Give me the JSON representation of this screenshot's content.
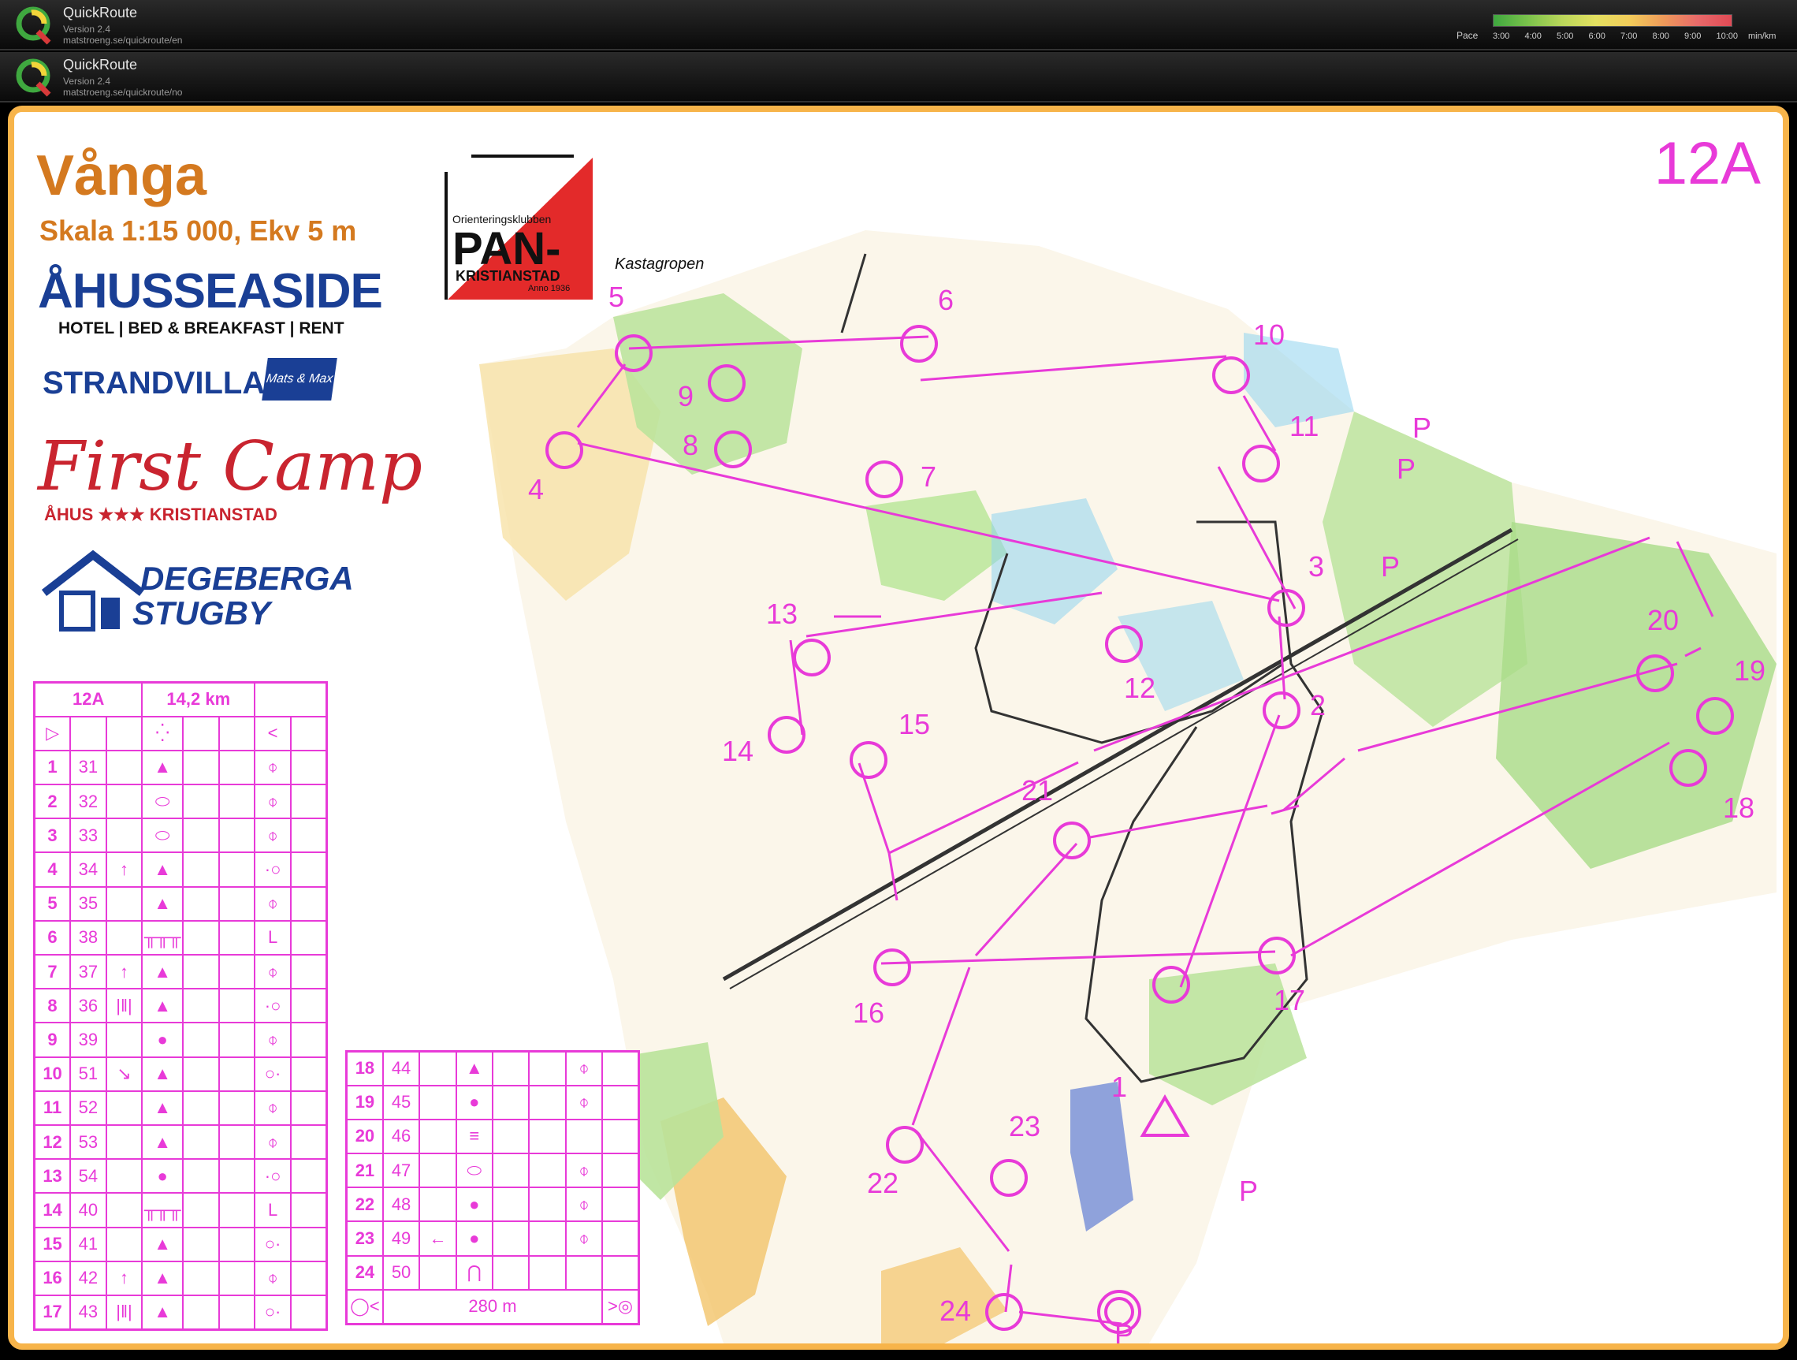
{
  "app_bars": [
    {
      "title": "QuickRoute",
      "version": "Version 2.4",
      "url": "matstroeng.se/quickroute/en"
    },
    {
      "title": "QuickRoute",
      "version": "Version 2.4",
      "url": "matstroeng.se/quickroute/no"
    }
  ],
  "pace_legend": {
    "label": "Pace",
    "ticks": [
      "3:00",
      "4:00",
      "5:00",
      "6:00",
      "7:00",
      "8:00",
      "9:00",
      "10:00",
      "min/km"
    ]
  },
  "map": {
    "title": "Vånga",
    "scale": "Skala 1:15 000, Ekv 5 m",
    "class_code": "12A",
    "place_name": "Kastagropen",
    "parking_label": "P",
    "control_labels": [
      "1",
      "2",
      "3",
      "4",
      "5",
      "6",
      "7",
      "8",
      "9",
      "10",
      "11",
      "12",
      "13",
      "14",
      "15",
      "16",
      "17",
      "18",
      "19",
      "20",
      "21",
      "22",
      "23",
      "24"
    ]
  },
  "club": {
    "small": "Orienteringsklubben",
    "big": "PAN-",
    "sub": "KRISTIANSTAD",
    "anno": "Anno 1936"
  },
  "sponsors": {
    "s1_big": "ÅHUSSEASIDE",
    "s1_small": "HOTEL | BED & BREAKFAST | RENT",
    "s2": "STRANDVILLAN",
    "s2_badge": "Mats & Max",
    "s3": "First Camp",
    "s3_sub": "ÅHUS ★★★ KRISTIANSTAD",
    "s4_line1": "DEGEBERGA",
    "s4_line2": "STUGBY"
  },
  "description": {
    "class": "12A",
    "length": "14,2 km",
    "finish_distance": "280 m",
    "rows_left": [
      {
        "n": "1",
        "code": "31",
        "dir": "",
        "sym": "▲",
        "loc": "⌽"
      },
      {
        "n": "2",
        "code": "32",
        "dir": "",
        "sym": "⬭",
        "loc": "⌽"
      },
      {
        "n": "3",
        "code": "33",
        "dir": "",
        "sym": "⬭",
        "loc": "⌽"
      },
      {
        "n": "4",
        "code": "34",
        "dir": "↑",
        "sym": "▲",
        "loc": "·○"
      },
      {
        "n": "5",
        "code": "35",
        "dir": "",
        "sym": "▲",
        "loc": "⌽"
      },
      {
        "n": "6",
        "code": "38",
        "dir": "",
        "sym": "╥╥╥",
        "loc": "L"
      },
      {
        "n": "7",
        "code": "37",
        "dir": "↑",
        "sym": "▲",
        "loc": "⌽"
      },
      {
        "n": "8",
        "code": "36",
        "dir": "|‖|",
        "sym": "▲",
        "loc": "·○"
      },
      {
        "n": "9",
        "code": "39",
        "dir": "",
        "sym": "●",
        "loc": "⌽"
      },
      {
        "n": "10",
        "code": "51",
        "dir": "↘",
        "sym": "▲",
        "loc": "○·"
      },
      {
        "n": "11",
        "code": "52",
        "dir": "",
        "sym": "▲",
        "loc": "⌽"
      },
      {
        "n": "12",
        "code": "53",
        "dir": "",
        "sym": "▲",
        "loc": "⌽"
      },
      {
        "n": "13",
        "code": "54",
        "dir": "",
        "sym": "●",
        "loc": "·○"
      },
      {
        "n": "14",
        "code": "40",
        "dir": "",
        "sym": "╥╥╥",
        "loc": "L"
      },
      {
        "n": "15",
        "code": "41",
        "dir": "",
        "sym": "▲",
        "loc": "○·"
      },
      {
        "n": "16",
        "code": "42",
        "dir": "↑",
        "sym": "▲",
        "loc": "⌽"
      },
      {
        "n": "17",
        "code": "43",
        "dir": "|‖|",
        "sym": "▲",
        "loc": "○·"
      }
    ],
    "rows_right": [
      {
        "n": "18",
        "code": "44",
        "dir": "",
        "sym": "▲",
        "loc": "⌽"
      },
      {
        "n": "19",
        "code": "45",
        "dir": "",
        "sym": "●",
        "loc": "⌽"
      },
      {
        "n": "20",
        "code": "46",
        "dir": "",
        "sym": "≡",
        "loc": ""
      },
      {
        "n": "21",
        "code": "47",
        "dir": "",
        "sym": "⬭",
        "loc": "⌽"
      },
      {
        "n": "22",
        "code": "48",
        "dir": "",
        "sym": "●",
        "loc": "⌽"
      },
      {
        "n": "23",
        "code": "49",
        "dir": "←",
        "sym": "●",
        "loc": "⌽"
      },
      {
        "n": "24",
        "code": "50",
        "dir": "",
        "sym": "⋂",
        "loc": ""
      }
    ]
  },
  "colors": {
    "overprint": "#e83ad8",
    "frame": "#f7b44a",
    "title_orange": "#d4791f",
    "forest_green": "#b9e39a",
    "open_yellow": "#f7e2a8",
    "marsh_blue": "#8fd3ee"
  }
}
